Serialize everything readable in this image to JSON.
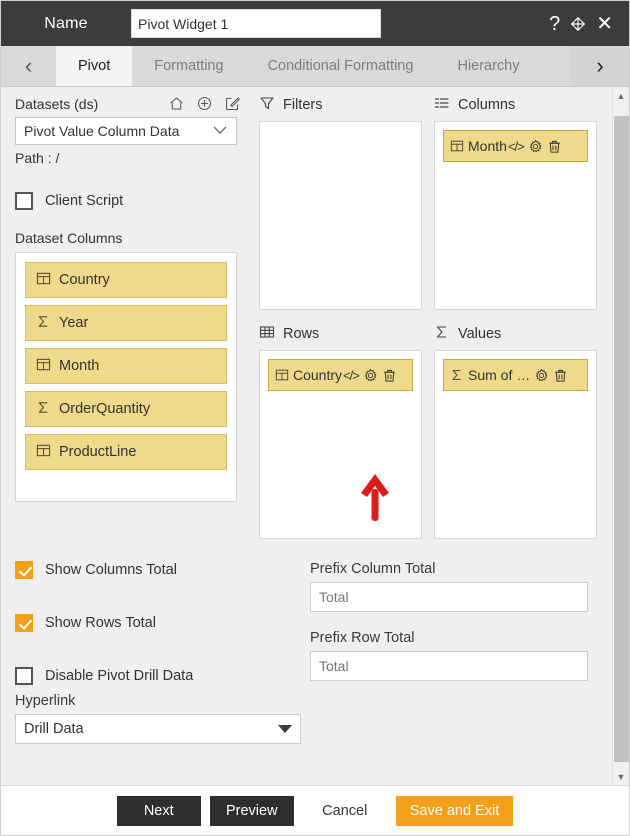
{
  "titlebar": {
    "name_label": "Name",
    "widget_name_value": "Pivot Widget 1",
    "widget_name_placeholder": "Pivot Widget 1",
    "help_icon": "?",
    "move_icon": "move-icon",
    "close_icon": "✕"
  },
  "tabbar": {
    "prev_arrow": "‹",
    "next_arrow": "›",
    "tabs": [
      {
        "label": "Pivot",
        "active": true
      },
      {
        "label": "Formatting",
        "active": false
      },
      {
        "label": "Conditional Formatting",
        "active": false
      },
      {
        "label": "Hierarchy",
        "active": false
      }
    ]
  },
  "datasets": {
    "title": "Datasets (ds)",
    "icons": [
      "home-icon",
      "add-circle-icon",
      "edit-square-icon"
    ],
    "selected": "Pivot Value Column Data",
    "caret": "⌄",
    "path_label": "Path :",
    "path_value": "/"
  },
  "client_script": {
    "label": "Client Script",
    "checked": false
  },
  "dataset_columns": {
    "title": "Dataset Columns",
    "items": [
      {
        "label": "Country",
        "type": "dimension"
      },
      {
        "label": "Year",
        "type": "measure"
      },
      {
        "label": "Month",
        "type": "dimension"
      },
      {
        "label": "OrderQuantity",
        "type": "measure"
      },
      {
        "label": "ProductLine",
        "type": "dimension"
      }
    ]
  },
  "zones": {
    "filters": {
      "title": "Filters",
      "icon": "funnel-icon",
      "chips": []
    },
    "columns": {
      "title": "Columns",
      "icon": "columns-list-icon",
      "chips": [
        {
          "label": "Month",
          "type": "dimension",
          "code_glyph": "</>"
        }
      ]
    },
    "rows": {
      "title": "Rows",
      "icon": "grid-table-icon",
      "chips": [
        {
          "label": "Country",
          "type": "dimension",
          "code_glyph": "</>"
        }
      ]
    },
    "values": {
      "title": "Values",
      "icon": "sigma-icon",
      "chips": [
        {
          "label": "Sum of …",
          "type": "measure",
          "code_glyph": ""
        }
      ]
    },
    "chip_actions": {
      "settings": "gear-icon",
      "delete": "trash-icon"
    }
  },
  "settings": {
    "show_columns_total": {
      "label": "Show Columns Total",
      "checked": true
    },
    "show_rows_total": {
      "label": "Show Rows Total",
      "checked": true
    },
    "disable_pivot_drill": {
      "label": "Disable Pivot Drill Data",
      "checked": false
    },
    "prefix_column_total": {
      "label": "Prefix Column Total",
      "value": "Total",
      "placeholder": "Total"
    },
    "prefix_row_total": {
      "label": "Prefix Row Total",
      "value": "Total",
      "placeholder": "Total"
    },
    "hyperlink": {
      "label": "Hyperlink",
      "selected": "Drill Data"
    }
  },
  "footer": {
    "next": "Next",
    "preview": "Preview",
    "cancel": "Cancel",
    "save_and_exit": "Save and Exit"
  },
  "annotation": {
    "type": "arrow-up",
    "color": "#e01b1b",
    "points_at": "rows-chip-gear-icon"
  },
  "colors": {
    "titlebar_bg": "#3c3c3c",
    "accent_orange": "#f5a01a",
    "chip_yellow": "#efd98a",
    "panel_bg": "#efefef",
    "annotation_red": "#e01b1b"
  },
  "scrollbar": {
    "up_arrow": "▲",
    "down_arrow": "▼"
  }
}
